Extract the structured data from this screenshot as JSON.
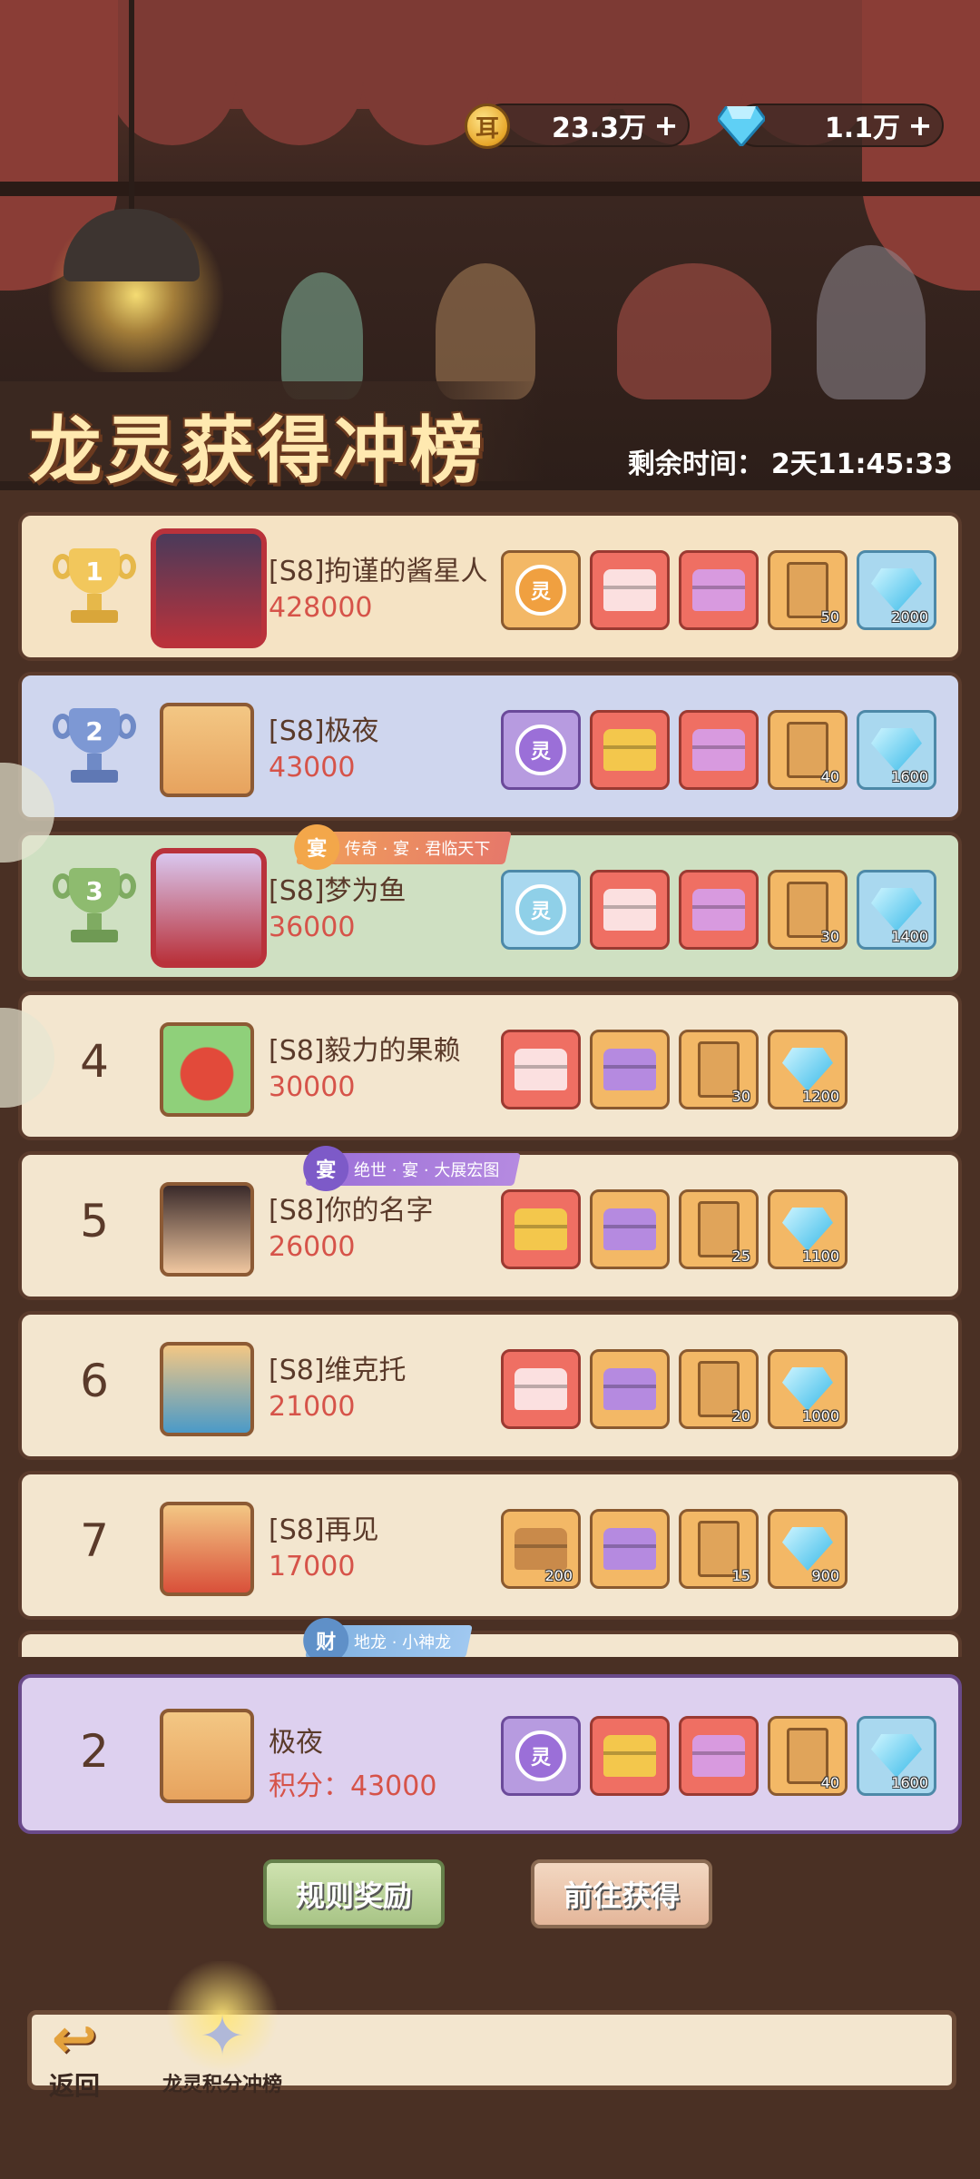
{
  "header": {
    "gold": "23.3万",
    "diamonds": "1.1万",
    "title": "龙灵获得冲榜",
    "countdown_label": "剩余时间：",
    "countdown_value": "2天11:45:33"
  },
  "ranks": [
    {
      "rank": "1",
      "name": "[S8]拘谨的酱星人",
      "score": "428000",
      "avatar_icon": "demon-dragon-portrait",
      "rewards": [
        {
          "icon": "soul-orb-gold",
          "color": "orange",
          "glyph": "灵",
          "qty": ""
        },
        {
          "icon": "chest-red",
          "color": "red",
          "qty": ""
        },
        {
          "icon": "chest-pink",
          "color": "red",
          "qty": ""
        },
        {
          "icon": "ticket",
          "color": "orange",
          "qty": "50"
        },
        {
          "icon": "diamond",
          "color": "blue",
          "qty": "2000"
        }
      ]
    },
    {
      "rank": "2",
      "name": "[S8]极夜",
      "score": "43000",
      "avatar_icon": "white-dragon-portrait",
      "rewards": [
        {
          "icon": "soul-orb-purple",
          "color": "purple",
          "glyph": "灵",
          "qty": ""
        },
        {
          "icon": "chest-gold",
          "color": "red",
          "qty": ""
        },
        {
          "icon": "chest-pink",
          "color": "red",
          "qty": ""
        },
        {
          "icon": "ticket",
          "color": "orange",
          "qty": "40"
        },
        {
          "icon": "diamond",
          "color": "blue",
          "qty": "1600"
        }
      ]
    },
    {
      "rank": "3",
      "name": "[S8]梦为鱼",
      "score": "36000",
      "avatar_icon": "armored-dragon-portrait",
      "title_tag": {
        "badge": "宴",
        "text": "传奇 · 宴 · 君临天下"
      },
      "rewards": [
        {
          "icon": "soul-orb-blue",
          "color": "blue",
          "glyph": "灵",
          "qty": ""
        },
        {
          "icon": "chest-red",
          "color": "red",
          "qty": ""
        },
        {
          "icon": "chest-pink",
          "color": "red",
          "qty": ""
        },
        {
          "icon": "ticket",
          "color": "orange",
          "qty": "30"
        },
        {
          "icon": "diamond",
          "color": "blue",
          "qty": "1400"
        }
      ]
    },
    {
      "rank": "4",
      "name": "[S8]毅力的果赖",
      "score": "30000",
      "avatar_icon": "red-slime-portrait",
      "rewards": [
        {
          "icon": "chest-red",
          "color": "red",
          "qty": ""
        },
        {
          "icon": "chest-purple",
          "color": "orange",
          "qty": ""
        },
        {
          "icon": "ticket",
          "color": "orange",
          "qty": "30"
        },
        {
          "icon": "diamond",
          "color": "orange",
          "qty": "1200"
        }
      ]
    },
    {
      "rank": "5",
      "name": "[S8]你的名字",
      "score": "26000",
      "avatar_icon": "horned-girl-portrait",
      "title_tag": {
        "badge": "宴",
        "text": "绝世 · 宴 · 大展宏图"
      },
      "rewards": [
        {
          "icon": "chest-gold",
          "color": "red",
          "qty": ""
        },
        {
          "icon": "chest-purple",
          "color": "orange",
          "qty": ""
        },
        {
          "icon": "ticket",
          "color": "orange",
          "qty": "25"
        },
        {
          "icon": "diamond",
          "color": "orange",
          "qty": "1100"
        }
      ]
    },
    {
      "rank": "6",
      "name": "[S8]维克托",
      "score": "21000",
      "avatar_icon": "blue-dragon-portrait",
      "rewards": [
        {
          "icon": "chest-red",
          "color": "red",
          "qty": ""
        },
        {
          "icon": "chest-purple",
          "color": "orange",
          "qty": ""
        },
        {
          "icon": "ticket",
          "color": "orange",
          "qty": "20"
        },
        {
          "icon": "diamond",
          "color": "orange",
          "qty": "1000"
        }
      ]
    },
    {
      "rank": "7",
      "name": "[S8]再见",
      "score": "17000",
      "avatar_icon": "fire-dragon-portrait",
      "rewards": [
        {
          "icon": "chest-wood",
          "color": "orange",
          "qty": "200"
        },
        {
          "icon": "chest-purple",
          "color": "orange",
          "qty": ""
        },
        {
          "icon": "ticket",
          "color": "orange",
          "qty": "15"
        },
        {
          "icon": "diamond",
          "color": "orange",
          "qty": "900"
        }
      ]
    }
  ],
  "partial_tag": {
    "badge": "财",
    "text": "地龙 · 小神龙"
  },
  "my_rank": {
    "rank": "2",
    "name": "极夜",
    "score_label": "积分：",
    "score": "43000",
    "avatar_icon": "white-dragon-portrait",
    "rewards": [
      {
        "icon": "soul-orb-purple",
        "color": "purple",
        "glyph": "灵",
        "qty": ""
      },
      {
        "icon": "chest-gold",
        "color": "red",
        "qty": ""
      },
      {
        "icon": "chest-pink",
        "color": "red",
        "qty": ""
      },
      {
        "icon": "ticket",
        "color": "orange",
        "qty": "40"
      },
      {
        "icon": "diamond",
        "color": "blue",
        "qty": "1600"
      }
    ]
  },
  "buttons": {
    "rules": "规则奖励",
    "goto": "前往获得"
  },
  "nav": {
    "back": "返回",
    "tab": "龙灵积分冲榜"
  },
  "colors": {
    "gold_row": "#f5e3c4",
    "silver_row": "#cfd6ee",
    "bronze_row": "#cfe0c2",
    "my_row": "#ddd0ef",
    "score_red": "#d65349"
  }
}
